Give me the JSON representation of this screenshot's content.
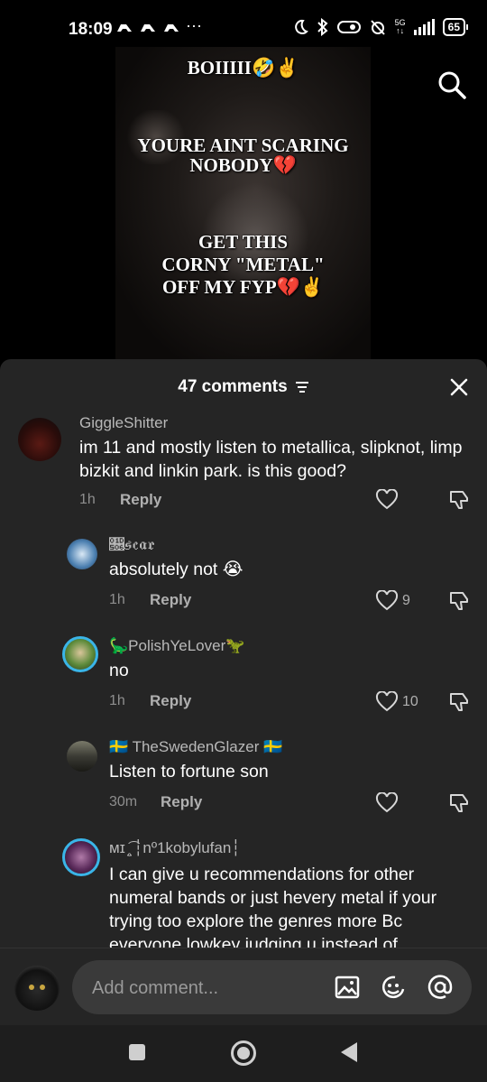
{
  "status_bar": {
    "time": "18:09",
    "app_icons": "☂☂☂",
    "more": "···",
    "network": "5G",
    "battery": "65"
  },
  "video": {
    "caption_lines": [
      "BOIIIII🤣✌️",
      "YOURE AINT SCARING",
      "NOBODY💔",
      "GET THIS",
      "CORNY \"METAL\"",
      "OFF MY FYP💔✌️"
    ]
  },
  "comments_panel": {
    "count_label": "47 comments",
    "comments": [
      {
        "username": "GiggleShitter",
        "text": "im 11 and mostly listen to metallica, slipknot, limp bizkit and linkin park. is this good?",
        "time": "1h",
        "reply_label": "Reply",
        "likes": ""
      },
      {
        "username": "𝔆𝔰𝔠𝔞𝔯",
        "text": "absolutely not 😭",
        "time": "1h",
        "reply_label": "Reply",
        "likes": "9"
      },
      {
        "username": "🦕PolishYeLover🦖",
        "text": "no",
        "time": "1h",
        "reply_label": "Reply",
        "likes": "10"
      },
      {
        "username": "🇸🇪 TheSwedenGlazer 🇸🇪",
        "text": "Listen to fortune son",
        "time": "30m",
        "reply_label": "Reply",
        "likes": ""
      },
      {
        "username": "ᴍɪ ̤̥͡ ┆nº1kobylufan┆",
        "text": "I can give u recommendations for other numeral bands or just hevery metal if your trying too explore the genres more Bc everyone lowkey judging u instead of",
        "time": "",
        "reply_label": "",
        "likes": ""
      }
    ]
  },
  "composer": {
    "placeholder": "Add comment..."
  },
  "colors": {
    "sheet_bg": "#252525",
    "input_bg": "#3a3a3a",
    "avatar_ring": "#3ab5e8"
  }
}
